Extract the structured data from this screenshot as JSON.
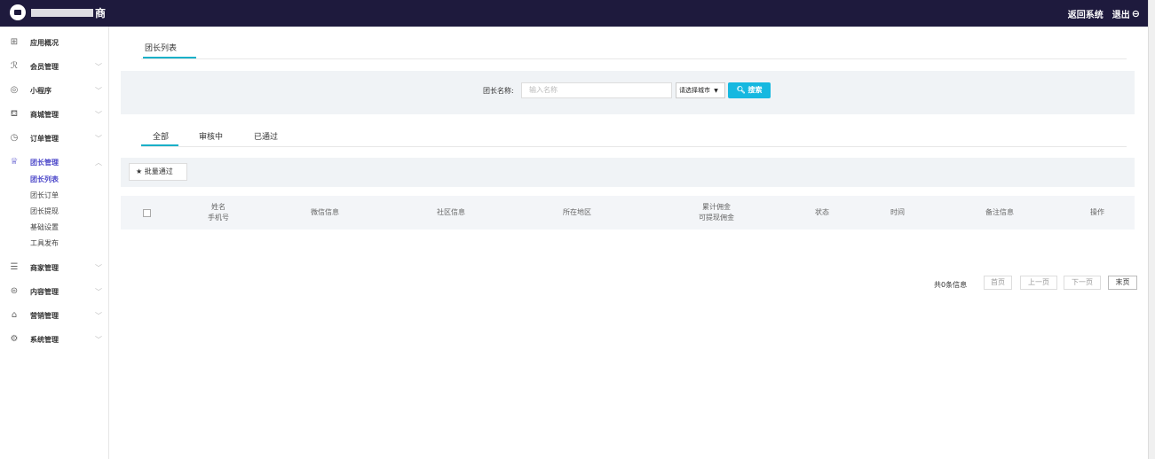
{
  "header": {
    "brand": "商",
    "back_label": "返回系统",
    "logout_label": "退出"
  },
  "sidebar": {
    "items": [
      {
        "label": "应用概况",
        "icon": "grid-icon",
        "glyph": "⊞"
      },
      {
        "label": "会员管理",
        "icon": "users-icon",
        "glyph": "ℛ"
      },
      {
        "label": "小程序",
        "icon": "miniapp-icon",
        "glyph": "◎"
      },
      {
        "label": "商城管理",
        "icon": "cart-icon",
        "glyph": "⛾"
      },
      {
        "label": "订单管理",
        "icon": "clock-icon",
        "glyph": "◷"
      },
      {
        "label": "团长管理",
        "icon": "crown-icon",
        "glyph": "♕"
      },
      {
        "label": "商家管理",
        "icon": "store-icon",
        "glyph": "☰"
      },
      {
        "label": "内容管理",
        "icon": "document-icon",
        "glyph": "⊜"
      },
      {
        "label": "营销管理",
        "icon": "chart-icon",
        "glyph": "⌂"
      },
      {
        "label": "系统管理",
        "icon": "settings-icon",
        "glyph": "⚙"
      }
    ],
    "sub_items": [
      "团长列表",
      "团长订单",
      "团长提现",
      "基础设置",
      "工具发布"
    ],
    "chevron_down": "﹀",
    "chevron_up": "︿"
  },
  "main": {
    "page_tab": "团长列表",
    "search": {
      "label": "团长名称:",
      "placeholder": "输入名称",
      "city_select": "请选择城市",
      "button": "搜索"
    },
    "tabs": [
      "全部",
      "审核中",
      "已通过"
    ],
    "batch_button": "批量通过",
    "table_headers": [
      {
        "line1": "姓名",
        "line2": "手机号"
      },
      {
        "line1": "微信信息",
        "line2": ""
      },
      {
        "line1": "社区信息",
        "line2": ""
      },
      {
        "line1": "所在地区",
        "line2": ""
      },
      {
        "line1": "累计佣金",
        "line2": "可提现佣金"
      },
      {
        "line1": "状态",
        "line2": ""
      },
      {
        "line1": "时间",
        "line2": ""
      },
      {
        "line1": "备注信息",
        "line2": ""
      },
      {
        "line1": "操作",
        "line2": ""
      }
    ],
    "pagination": {
      "info": "共0条信息",
      "first": "首页",
      "prev": "上一页",
      "next": "下一页",
      "last": "末页"
    }
  },
  "colors": {
    "topbar": "#1e1a3d",
    "accent": "#19b0c8",
    "search_button": "#16b8e0",
    "active_nav": "#4b46c9"
  }
}
